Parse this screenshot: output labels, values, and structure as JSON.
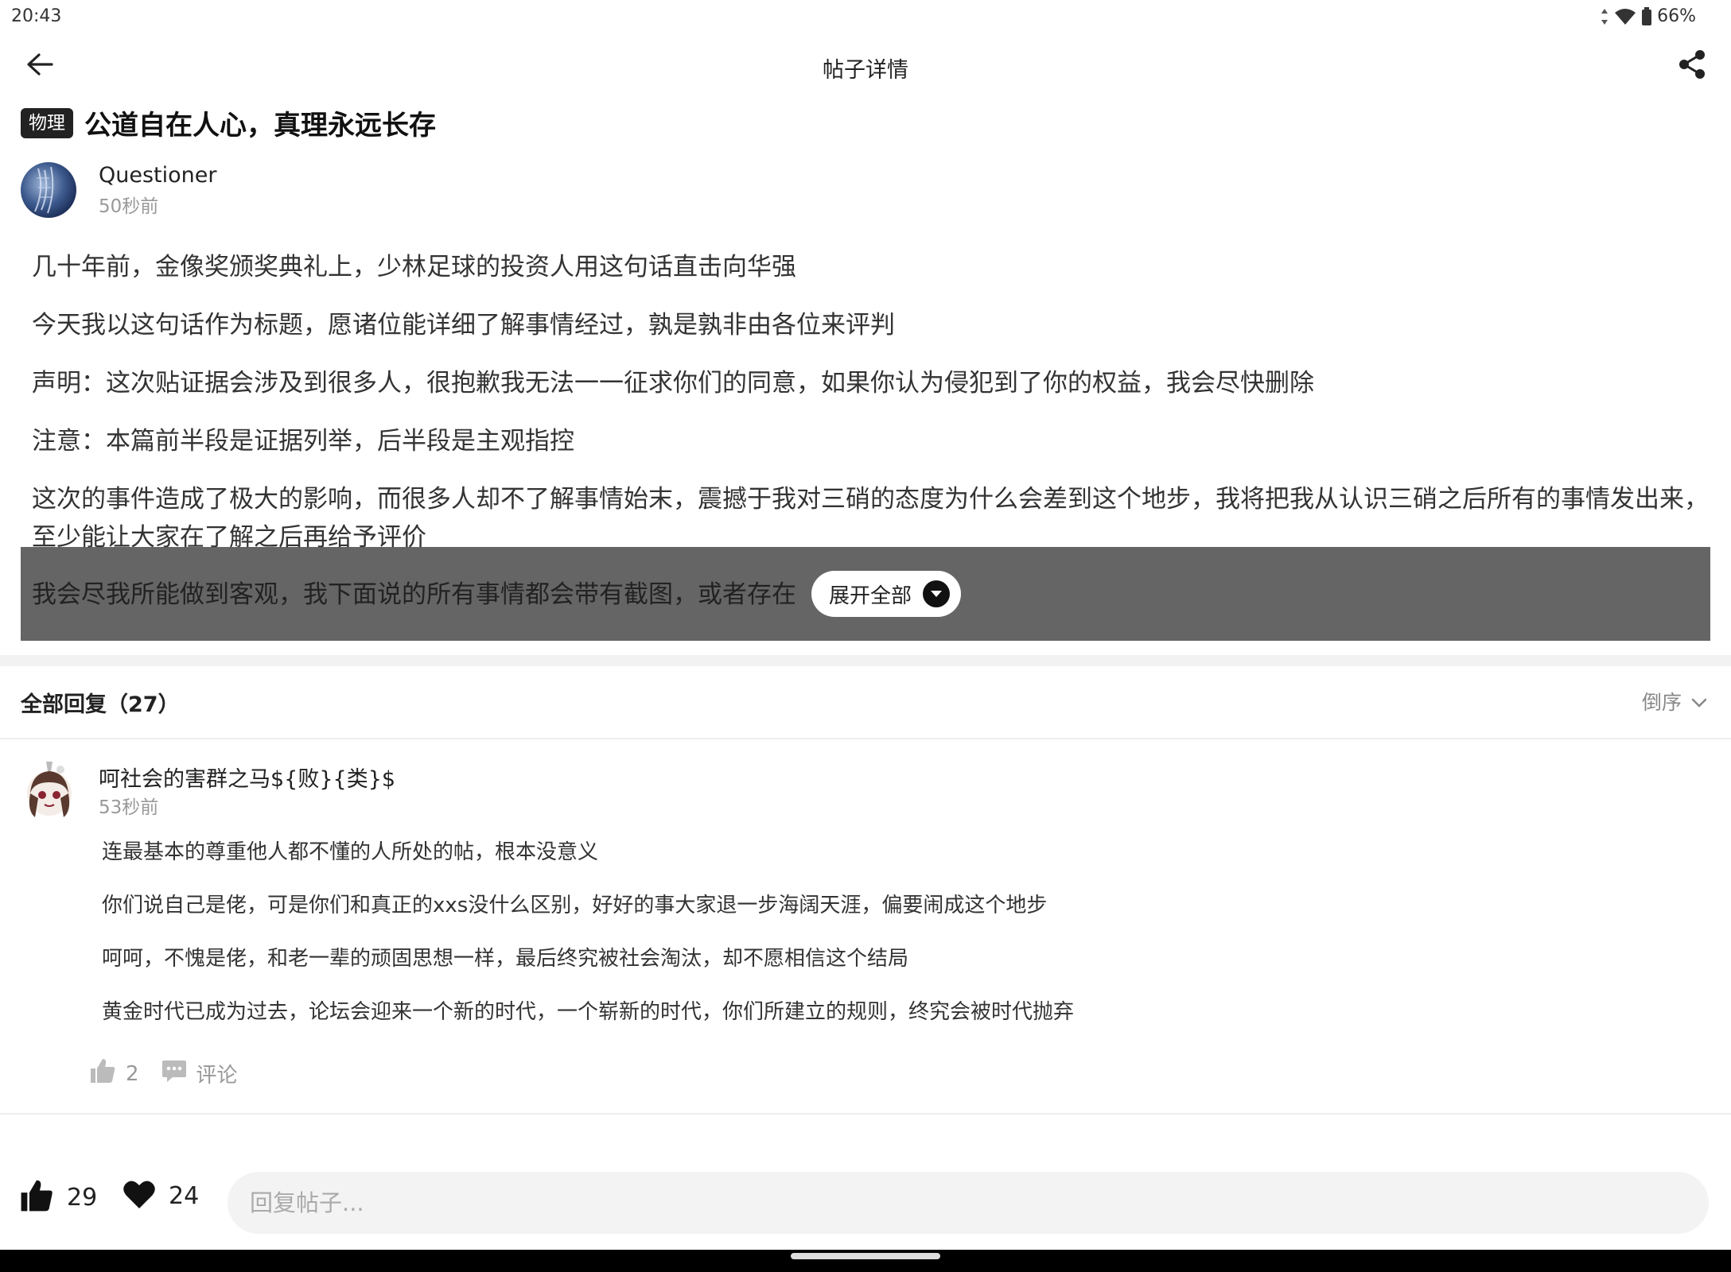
{
  "status_bar": {
    "time": "20:43",
    "battery": "66%",
    "icons": [
      "data-arrows-icon",
      "wifi-icon",
      "battery-icon"
    ]
  },
  "app_bar": {
    "title": "帖子详情",
    "back_icon": "back-arrow-icon",
    "share_icon": "share-icon"
  },
  "post": {
    "category": "物理",
    "title": "公道自在人心，真理永远长存",
    "author": "Questioner",
    "time": "50秒前",
    "paragraphs": [
      "几十年前，金像奖颁奖典礼上，少林足球的投资人用这句话直击向华强",
      "今天我以这句话作为标题，愿诸位能详细了解事情经过，孰是孰非由各位来评判",
      "声明：这次贴证据会涉及到很多人，很抱歉我无法一一征求你们的同意，如果你认为侵犯到了你的权益，我会尽快删除",
      "注意：本篇前半段是证据列举，后半段是主观指控",
      "这次的事件造成了极大的影响，而很多人却不了解事情始末，震撼于我对三硝的态度为什么会差到这个地步，我将把我从认识三硝之后所有的事情发出来，至少能让大家在了解之后再给予评价"
    ],
    "truncated_line": "我会尽我所能做到客观，我下面说的所有事情都会带有截图，或者存在",
    "expand_label": "展开全部"
  },
  "replies": {
    "header": "全部回复（27）",
    "sort_label": "倒序",
    "items": [
      {
        "author": "呵社会的害群之马${败}{类}$",
        "time": "53秒前",
        "lines": [
          "连最基本的尊重他人都不懂的人所处的帖，根本没意义",
          "你们说自己是佬，可是你们和真正的xxs没什么区别，好好的事大家退一步海阔天涯，偏要闹成这个地步",
          "呵呵，不愧是佬，和老一辈的顽固思想一样，最后终究被社会淘汰，却不愿相信这个结局",
          "黄金时代已成为过去，论坛会迎来一个新的时代，一个崭新的时代，你们所建立的规则，终究会被时代抛弃"
        ],
        "likes": "2",
        "comment_label": "评论"
      }
    ]
  },
  "bottom_bar": {
    "likes": "29",
    "favorites": "24",
    "reply_placeholder": "回复帖子..."
  }
}
